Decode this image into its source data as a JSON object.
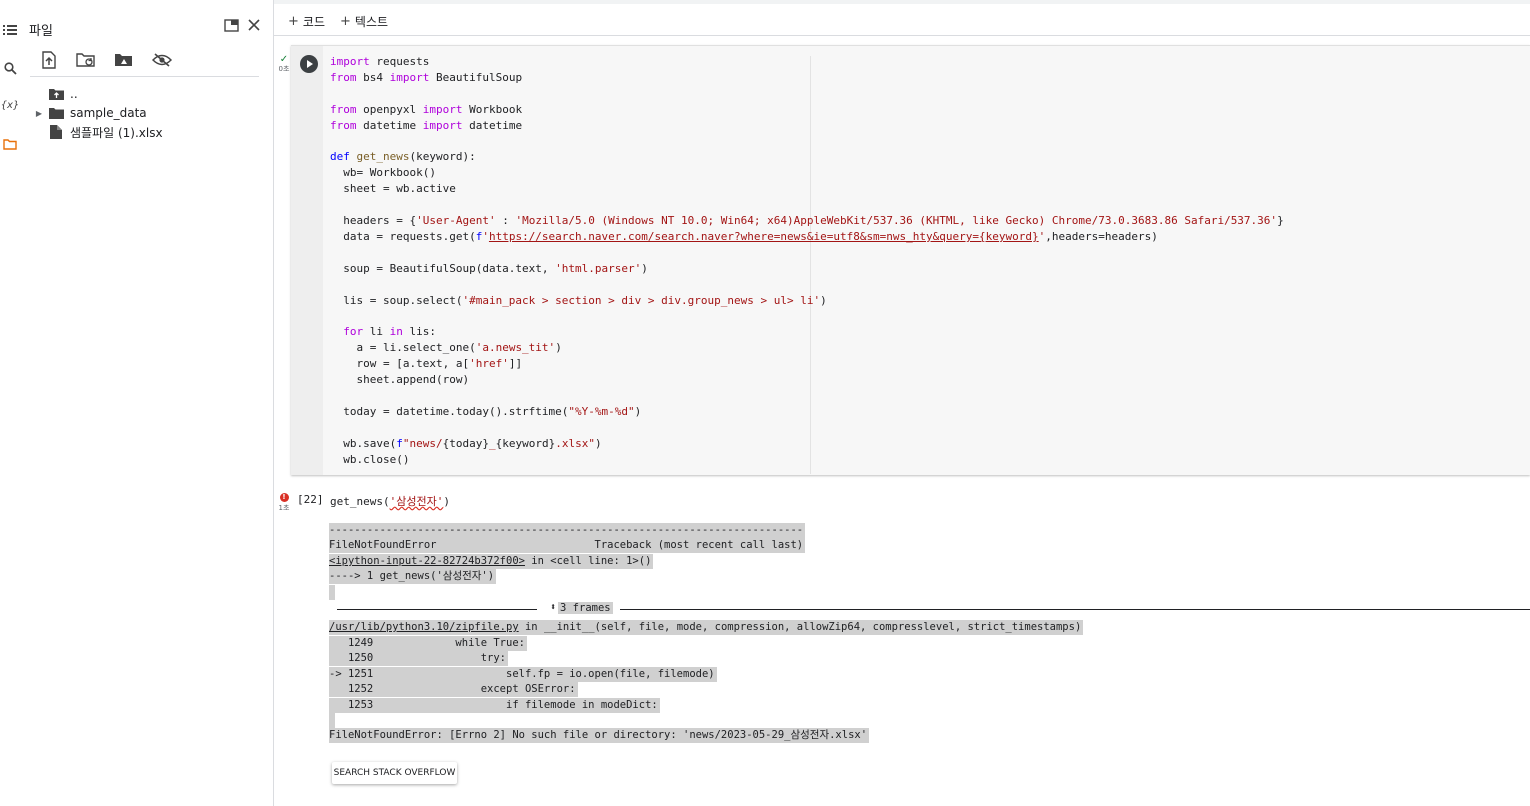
{
  "rail": {
    "icons": [
      "toc-icon",
      "search-icon",
      "variables-icon",
      "folder-icon"
    ],
    "variables_label": "{x}"
  },
  "files_panel": {
    "title": "파일",
    "tree": [
      {
        "name": "..",
        "type": "parent-folder"
      },
      {
        "name": "sample_data",
        "type": "folder"
      },
      {
        "name": "샘플파일 (1).xlsx",
        "type": "file"
      }
    ]
  },
  "toolbar": {
    "add_code_label": "코드",
    "add_text_label": "텍스트"
  },
  "cell1": {
    "status_check": "✓",
    "exec_time": "0초"
  },
  "cell2": {
    "exec_count": "[22]",
    "code_prefix": "get_news(",
    "code_arg": "'삼성전자'",
    "code_suffix": ")",
    "exec_time": "1초",
    "error_mark": "!"
  },
  "output": {
    "dashes": "---------------------------------------------------------------------------",
    "error_line": "FileNotFoundError                         Traceback (most recent call last)",
    "input_link": "<ipython-input-22-82724b372f00>",
    "input_rest": " in <cell line: 1>()",
    "arrow_line": "----> 1 get_news('삼성전자')",
    "frames_label": "3 frames",
    "zipfile_link": "/usr/lib/python3.10/zipfile.py",
    "zipfile_rest": " in __init__(self, file, mode, compression, allowZip64, compresslevel, strict_timestamps)",
    "frame_lines": [
      "   1249             while True:",
      "   1250                 try:",
      "-> 1251                     self.fp = io.open(file, filemode)",
      "   1252                 except OSError:",
      "   1253                     if filemode in modeDict:"
    ],
    "final_error": "FileNotFoundError: [Errno 2] No such file or directory: 'news/2023-05-29_삼성전자.xlsx'",
    "so_button": "SEARCH STACK OVERFLOW"
  },
  "colors": {
    "keyword": "#af00db",
    "keyword_blue": "#0000ff",
    "string": "#a31515",
    "function": "#795e26",
    "error_red": "#d93025",
    "success_green": "#188038",
    "traceback_bg": "#d0d0d0"
  }
}
